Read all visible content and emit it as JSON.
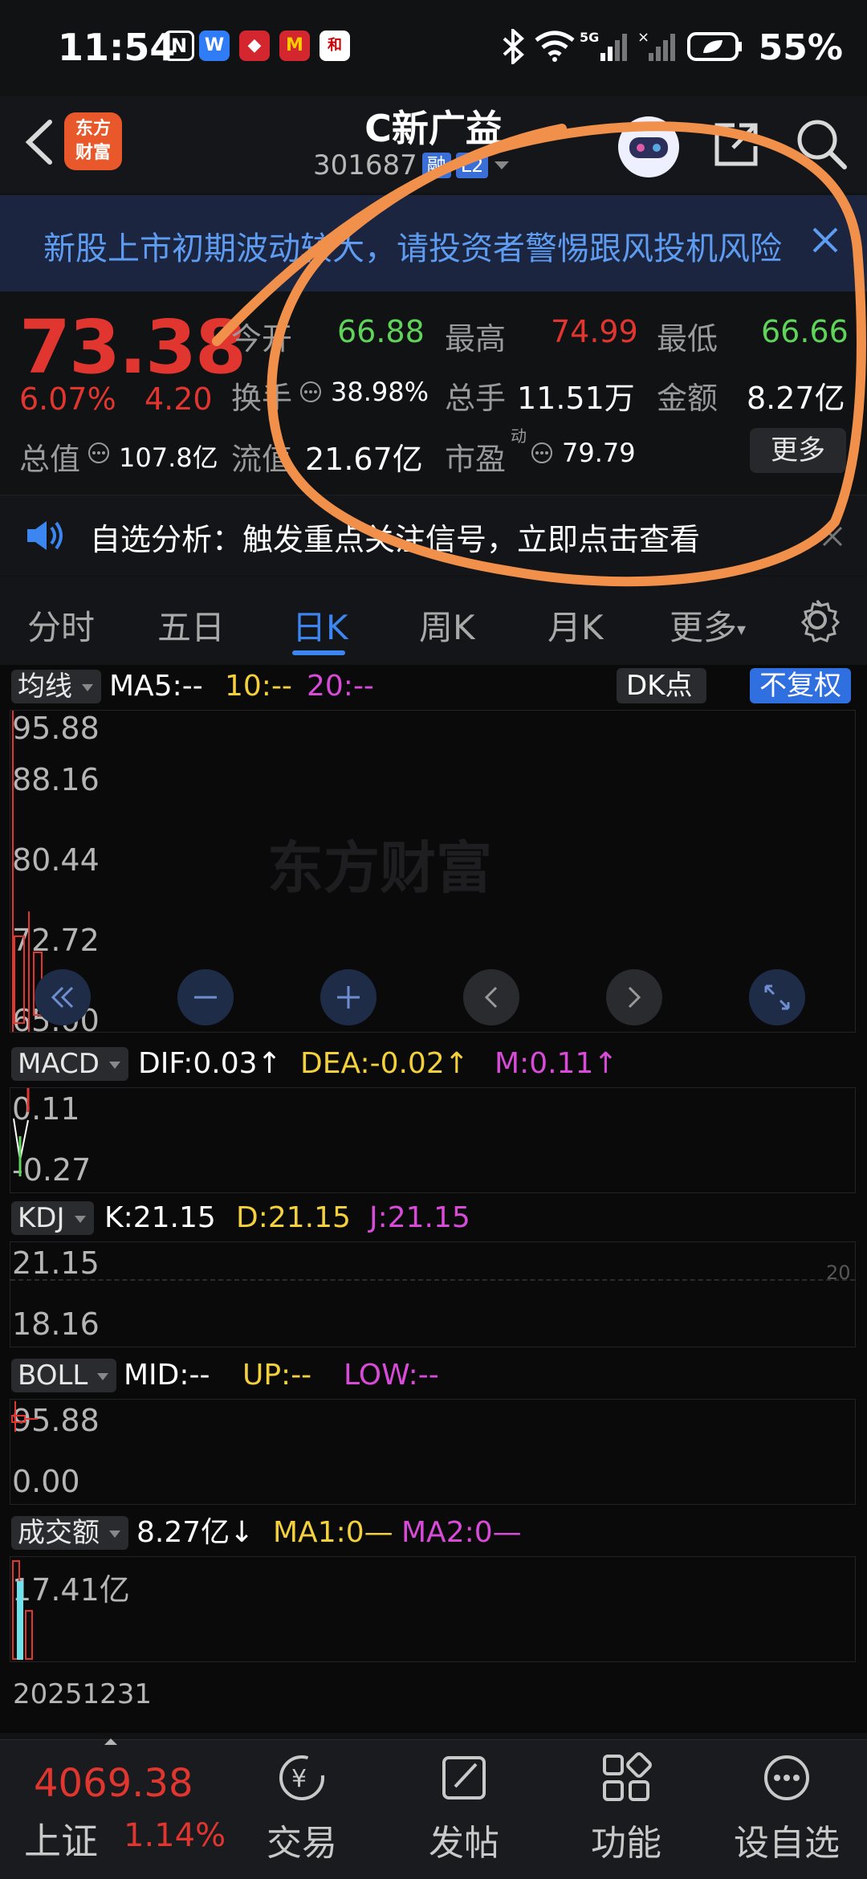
{
  "status_bar": {
    "time": "11:54",
    "battery": "55%",
    "app_icons": [
      "nfc-icon",
      "weixin-app-icon",
      "pinduoduo-app-icon",
      "mcdonalds-app-icon",
      "hexun-app-icon"
    ]
  },
  "header": {
    "title": "C新广益",
    "stock_code": "301687",
    "tags": [
      "融",
      "L2"
    ],
    "logo_text": [
      "东方",
      "财富"
    ]
  },
  "banner": {
    "text": "新股上市初期波动较大，请投资者警惕跟风投机风险"
  },
  "quote": {
    "price": "73.38",
    "change_pct": "6.07%",
    "change": "4.20",
    "total_value_label": "总值",
    "total_value": "107.8亿",
    "open_label": "今开",
    "open": "66.88",
    "high_label": "最高",
    "high": "74.99",
    "low_label": "最低",
    "low": "66.66",
    "turnover_label": "换手",
    "turnover": "38.98%",
    "volume_label": "总手",
    "volume": "11.51万",
    "amount_label": "金额",
    "amount": "8.27亿",
    "float_value_label": "流值",
    "float_value": "21.67亿",
    "pe_label": "市盈",
    "pe_sup": "动",
    "pe": "79.79",
    "more_button": "更多"
  },
  "analysis": {
    "text": "自选分析：触发重点关注信号，立即点击查看"
  },
  "tabs": [
    {
      "label": "分时",
      "active": false
    },
    {
      "label": "五日",
      "active": false
    },
    {
      "label": "日K",
      "active": true
    },
    {
      "label": "周K",
      "active": false
    },
    {
      "label": "月K",
      "active": false
    },
    {
      "label": "更多",
      "active": false
    }
  ],
  "chart": {
    "ma": {
      "btn": "均线",
      "ma5": "MA5:--",
      "ma10": "10:--",
      "ma20": "20:--",
      "dk_button": "DK点",
      "fq_button": "不复权"
    },
    "price_axis": [
      "95.88",
      "88.16",
      "80.44",
      "72.72",
      "65.00"
    ],
    "watermark": "东方财富",
    "macd": {
      "btn": "MACD",
      "dif": "DIF:0.03↑",
      "dea": "DEA:-0.02↑",
      "m": "M:0.11↑",
      "axis": [
        "0.11",
        "-0.27"
      ]
    },
    "kdj": {
      "btn": "KDJ",
      "k": "K:21.15",
      "d": "D:21.15",
      "j": "J:21.15",
      "axis": [
        "21.15",
        "18.16"
      ],
      "ref": "20"
    },
    "boll": {
      "btn": "BOLL",
      "mid": "MID:--",
      "up": "UP:--",
      "low": "LOW:--",
      "axis": [
        "95.88",
        "0.00"
      ]
    },
    "vol": {
      "btn": "成交额",
      "amount": "8.27亿↓",
      "ma1": "MA1:0—",
      "ma2": "MA2:0—",
      "axis": [
        "17.41亿"
      ]
    },
    "date": "20251231"
  },
  "bottom_bar": {
    "index_value": "4069.38",
    "index_name": "上证",
    "index_pct": "1.14%",
    "items": [
      "交易",
      "发帖",
      "功能",
      "设自选"
    ]
  }
}
